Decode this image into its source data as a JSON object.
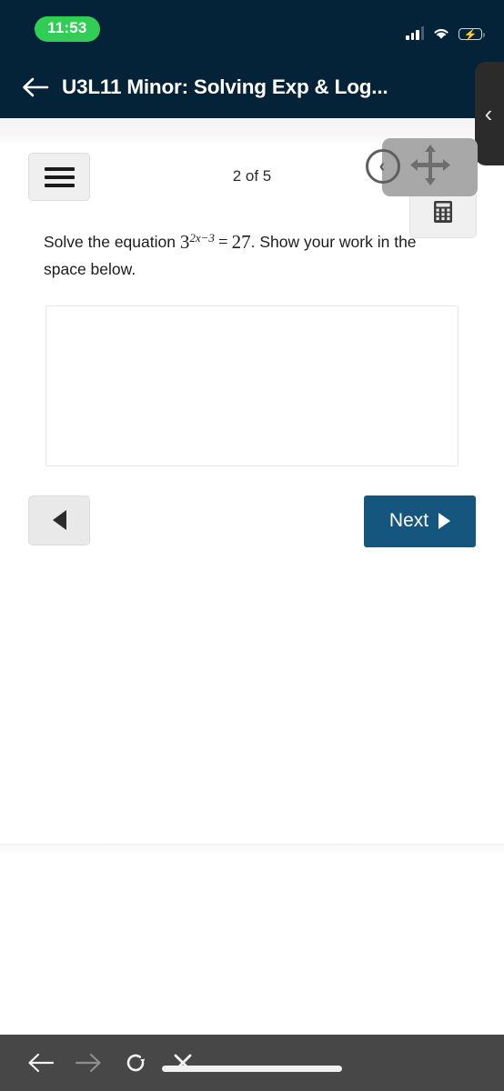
{
  "status_bar": {
    "time": "11:53",
    "signal_icon": "cellular-signal-icon",
    "wifi_icon": "wifi-icon",
    "battery_icon": "battery-charging-icon",
    "background_color": "#042338",
    "time_pill_color": "#31cd55"
  },
  "app_header": {
    "back_icon": "back-arrow-icon",
    "title": "U3L11 Minor: Solving Exp & Log...",
    "background_color": "#042338"
  },
  "edge_panel": {
    "handle_icon": "chevron-left-icon",
    "handle_glyph": "‹"
  },
  "toolbar": {
    "menu_icon": "hamburger-menu-icon",
    "pager_label": "2 of 5",
    "calculator_icon": "calculator-icon",
    "move_icon": "move-four-arrows-icon",
    "overlay_back_icon": "circle-chevron-left-icon",
    "overlay_back_glyph": "‹",
    "drag_panel_color": "#a8a8a8"
  },
  "question": {
    "lead_text": "Solve the equation ",
    "math_base": "3",
    "math_exponent": "2x−3",
    "math_equals": "=",
    "math_result": "27",
    "trail_text": ". Show your work in the space below.",
    "answer_value": "",
    "answer_placeholder": ""
  },
  "navigation": {
    "prev_icon": "triangle-left-icon",
    "prev_label": "",
    "next_label": "Next",
    "next_icon": "triangle-right-icon",
    "next_color": "#15567f"
  },
  "browser_bar": {
    "back_icon": "arrow-left-icon",
    "forward_icon": "arrow-right-icon",
    "reload_icon": "reload-icon",
    "stop_icon": "close-x-icon",
    "url_value": "",
    "background_color": "#474747"
  }
}
